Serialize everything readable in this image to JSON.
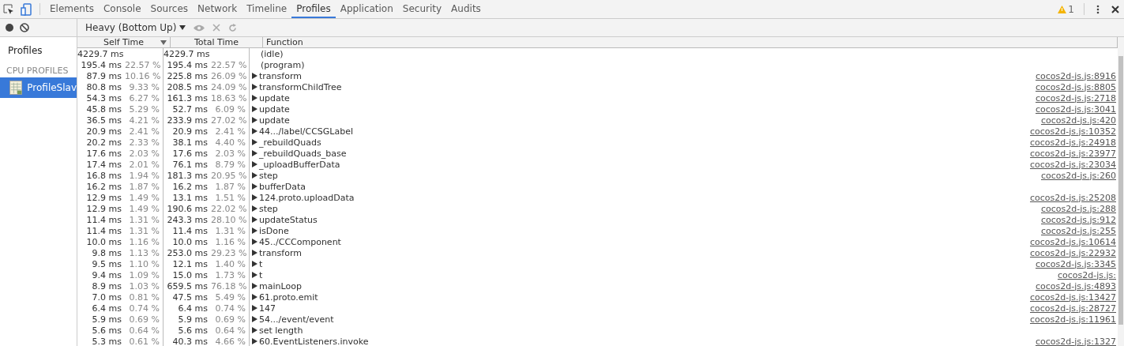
{
  "tabs": [
    {
      "label": "Elements",
      "selected": false
    },
    {
      "label": "Console",
      "selected": false
    },
    {
      "label": "Sources",
      "selected": false
    },
    {
      "label": "Network",
      "selected": false
    },
    {
      "label": "Timeline",
      "selected": false
    },
    {
      "label": "Profiles",
      "selected": true
    },
    {
      "label": "Application",
      "selected": false
    },
    {
      "label": "Security",
      "selected": false
    },
    {
      "label": "Audits",
      "selected": false
    }
  ],
  "warning_count": "1",
  "sidebar": {
    "title": "Profiles",
    "section": "CPU PROFILES",
    "items": [
      {
        "label": "ProfileSlav",
        "selected": true
      }
    ]
  },
  "toolbar": {
    "view": "Heavy (Bottom Up)"
  },
  "table": {
    "columns": [
      "Self Time",
      "Total Time",
      "Function"
    ],
    "rows": [
      {
        "self": "4229.7 ms",
        "self_pct": "",
        "total": "4229.7 ms",
        "total_pct": "",
        "function": "(idle)",
        "link": "",
        "expandable": false
      },
      {
        "self": "195.4 ms",
        "self_pct": "22.57 %",
        "total": "195.4 ms",
        "total_pct": "22.57 %",
        "function": "(program)",
        "link": "",
        "expandable": false
      },
      {
        "self": "87.9 ms",
        "self_pct": "10.16 %",
        "total": "225.8 ms",
        "total_pct": "26.09 %",
        "function": "transform",
        "link": "cocos2d-js.js:8916",
        "expandable": true
      },
      {
        "self": "80.8 ms",
        "self_pct": "9.33 %",
        "total": "208.5 ms",
        "total_pct": "24.09 %",
        "function": "transformChildTree",
        "link": "cocos2d-js.js:8805",
        "expandable": true
      },
      {
        "self": "54.3 ms",
        "self_pct": "6.27 %",
        "total": "161.3 ms",
        "total_pct": "18.63 %",
        "function": "update",
        "link": "cocos2d-js.js:2718",
        "expandable": true
      },
      {
        "self": "45.8 ms",
        "self_pct": "5.29 %",
        "total": "52.7 ms",
        "total_pct": "6.09 %",
        "function": "update",
        "link": "cocos2d-js.js:3041",
        "expandable": true
      },
      {
        "self": "36.5 ms",
        "self_pct": "4.21 %",
        "total": "233.9 ms",
        "total_pct": "27.02 %",
        "function": "update",
        "link": "cocos2d-js.js:420",
        "expandable": true
      },
      {
        "self": "20.9 ms",
        "self_pct": "2.41 %",
        "total": "20.9 ms",
        "total_pct": "2.41 %",
        "function": "44.../label/CCSGLabel",
        "link": "cocos2d-js.js:10352",
        "expandable": true
      },
      {
        "self": "20.2 ms",
        "self_pct": "2.33 %",
        "total": "38.1 ms",
        "total_pct": "4.40 %",
        "function": "_rebuildQuads",
        "link": "cocos2d-js.js:24918",
        "expandable": true
      },
      {
        "self": "17.6 ms",
        "self_pct": "2.03 %",
        "total": "17.6 ms",
        "total_pct": "2.03 %",
        "function": "_rebuildQuads_base",
        "link": "cocos2d-js.js:23977",
        "expandable": true
      },
      {
        "self": "17.4 ms",
        "self_pct": "2.01 %",
        "total": "76.1 ms",
        "total_pct": "8.79 %",
        "function": "_uploadBufferData",
        "link": "cocos2d-js.js:23034",
        "expandable": true
      },
      {
        "self": "16.8 ms",
        "self_pct": "1.94 %",
        "total": "181.3 ms",
        "total_pct": "20.95 %",
        "function": "step",
        "link": "cocos2d-js.js:260",
        "expandable": true
      },
      {
        "self": "16.2 ms",
        "self_pct": "1.87 %",
        "total": "16.2 ms",
        "total_pct": "1.87 %",
        "function": "bufferData",
        "link": "",
        "expandable": true
      },
      {
        "self": "12.9 ms",
        "self_pct": "1.49 %",
        "total": "13.1 ms",
        "total_pct": "1.51 %",
        "function": "124.proto.uploadData",
        "link": "cocos2d-js.js:25208",
        "expandable": true
      },
      {
        "self": "12.9 ms",
        "self_pct": "1.49 %",
        "total": "190.6 ms",
        "total_pct": "22.02 %",
        "function": "step",
        "link": "cocos2d-js.js:288",
        "expandable": true
      },
      {
        "self": "11.4 ms",
        "self_pct": "1.31 %",
        "total": "243.3 ms",
        "total_pct": "28.10 %",
        "function": "updateStatus",
        "link": "cocos2d-js.js:912",
        "expandable": true
      },
      {
        "self": "11.4 ms",
        "self_pct": "1.31 %",
        "total": "11.4 ms",
        "total_pct": "1.31 %",
        "function": "isDone",
        "link": "cocos2d-js.js:255",
        "expandable": true
      },
      {
        "self": "10.0 ms",
        "self_pct": "1.16 %",
        "total": "10.0 ms",
        "total_pct": "1.16 %",
        "function": "45../CCComponent",
        "link": "cocos2d-js.js:10614",
        "expandable": true
      },
      {
        "self": "9.8 ms",
        "self_pct": "1.13 %",
        "total": "253.0 ms",
        "total_pct": "29.23 %",
        "function": "transform",
        "link": "cocos2d-js.js:22932",
        "expandable": true
      },
      {
        "self": "9.5 ms",
        "self_pct": "1.10 %",
        "total": "12.1 ms",
        "total_pct": "1.40 %",
        "function": "t",
        "link": "cocos2d-js.js:3345",
        "expandable": true
      },
      {
        "self": "9.4 ms",
        "self_pct": "1.09 %",
        "total": "15.0 ms",
        "total_pct": "1.73 %",
        "function": "t",
        "link": "cocos2d-js.js:",
        "expandable": true
      },
      {
        "self": "8.9 ms",
        "self_pct": "1.03 %",
        "total": "659.5 ms",
        "total_pct": "76.18 %",
        "function": "mainLoop",
        "link": "cocos2d-js.js:4893",
        "expandable": true
      },
      {
        "self": "7.0 ms",
        "self_pct": "0.81 %",
        "total": "47.5 ms",
        "total_pct": "5.49 %",
        "function": "61.proto.emit",
        "link": "cocos2d-js.js:13427",
        "expandable": true
      },
      {
        "self": "6.4 ms",
        "self_pct": "0.74 %",
        "total": "6.4 ms",
        "total_pct": "0.74 %",
        "function": "147",
        "link": "cocos2d-js.js:28727",
        "expandable": true
      },
      {
        "self": "5.9 ms",
        "self_pct": "0.69 %",
        "total": "5.9 ms",
        "total_pct": "0.69 %",
        "function": "54.../event/event",
        "link": "cocos2d-js.js:11961",
        "expandable": true
      },
      {
        "self": "5.6 ms",
        "self_pct": "0.64 %",
        "total": "5.6 ms",
        "total_pct": "0.64 %",
        "function": "set length",
        "link": "",
        "expandable": true
      },
      {
        "self": "5.3 ms",
        "self_pct": "0.61 %",
        "total": "40.3 ms",
        "total_pct": "4.66 %",
        "function": "60.EventListeners.invoke",
        "link": "cocos2d-js.js:1327",
        "expandable": true
      }
    ]
  }
}
